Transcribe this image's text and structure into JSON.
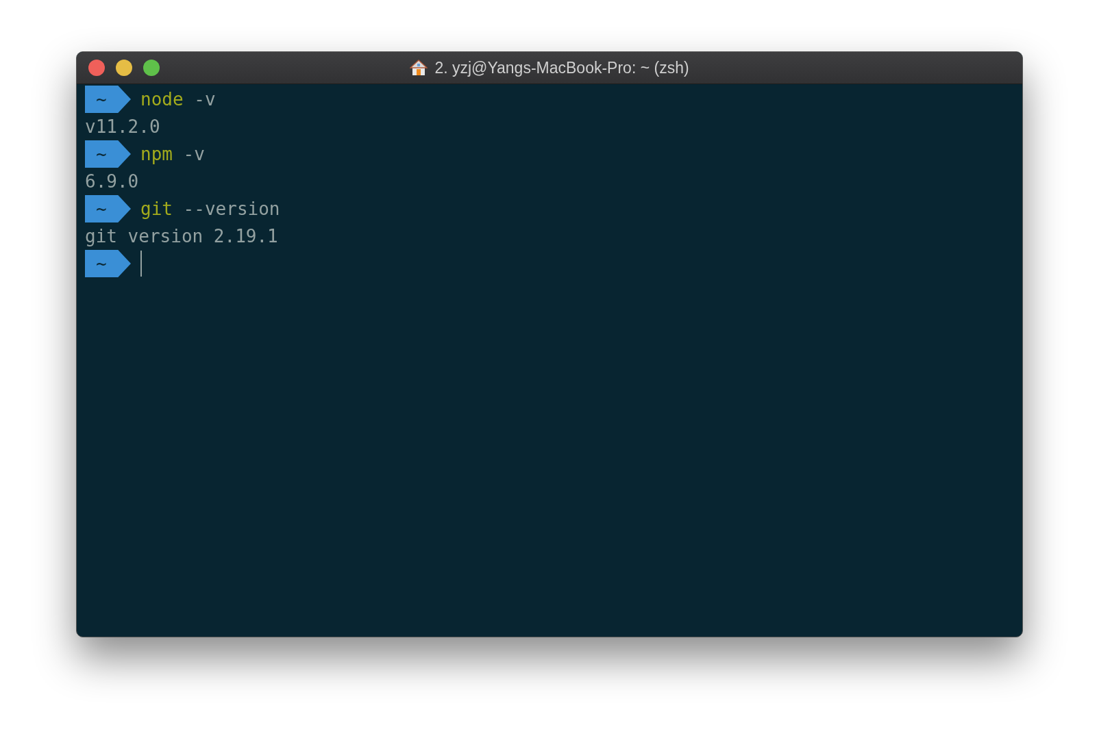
{
  "window": {
    "title": "2. yzj@Yangs-MacBook-Pro: ~ (zsh)"
  },
  "lines": [
    {
      "kind": "command",
      "prompt": "~",
      "program": "node",
      "args": "-v"
    },
    {
      "kind": "output",
      "text": "v11.2.0"
    },
    {
      "kind": "command",
      "prompt": "~",
      "program": "npm",
      "args": "-v"
    },
    {
      "kind": "output",
      "text": "6.9.0"
    },
    {
      "kind": "command",
      "prompt": "~",
      "program": "git",
      "args": "--version"
    },
    {
      "kind": "output",
      "text": "git version 2.19.1"
    },
    {
      "kind": "prompt",
      "prompt": "~",
      "cursor": true
    }
  ]
}
